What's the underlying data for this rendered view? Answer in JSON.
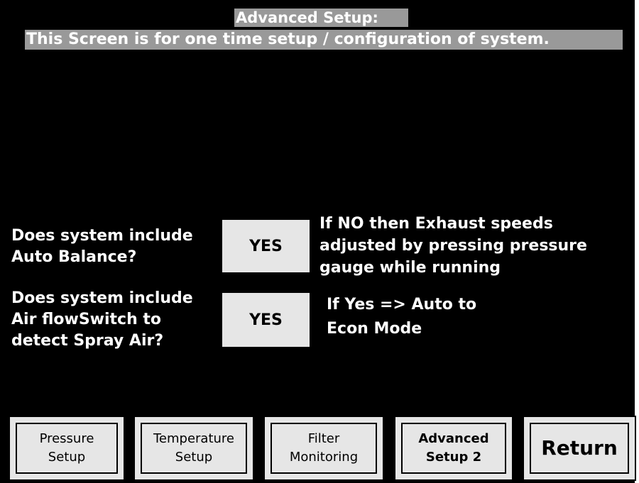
{
  "header": {
    "title": "Advanced Setup:",
    "subtitle": "This Screen is for one time setup / configuration  of system."
  },
  "questions": [
    {
      "line1": "Does system include",
      "line2": "Auto Balance?",
      "button": "YES",
      "note1": "If NO then Exhaust speeds",
      "note2": "adjusted by pressing pressure",
      "note3": "gauge while running"
    },
    {
      "line1": "Does system include",
      "line2": "Air flowSwitch to",
      "line3": "detect Spray Air?",
      "button": "YES",
      "note1": "If Yes => Auto to",
      "note2": "Econ Mode"
    }
  ],
  "nav": [
    {
      "line1": "Pressure",
      "line2": "Setup"
    },
    {
      "line1": "Temperature",
      "line2": "Setup"
    },
    {
      "line1": "Filter",
      "line2": "Monitoring"
    },
    {
      "line1": "Advanced",
      "line2": "Setup 2"
    },
    {
      "line1": "Return"
    }
  ],
  "colors": {
    "background": "#000000",
    "header_bg": "#999999",
    "button_bg": "#e6e6e6",
    "text": "#ffffff"
  }
}
